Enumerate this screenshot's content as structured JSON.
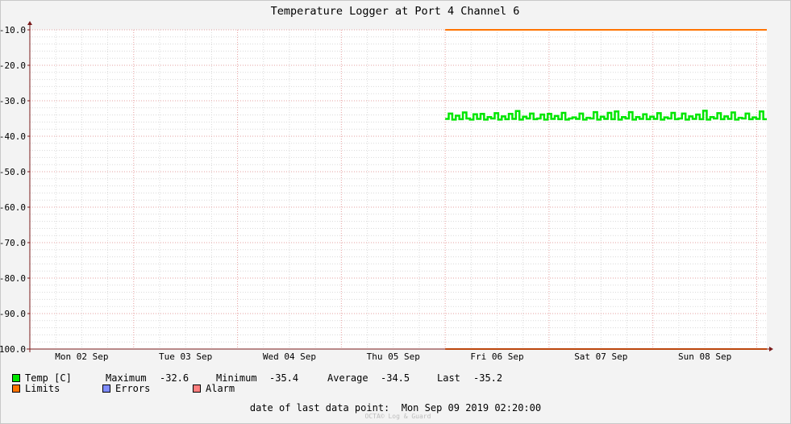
{
  "chart_data": {
    "type": "line",
    "title": "Temperature Logger at Port 4 Channel 6",
    "ylim": [
      -100,
      -10
    ],
    "y_ticks": [
      -10,
      -20,
      -30,
      -40,
      -50,
      -60,
      -70,
      -80,
      -90,
      -100
    ],
    "y_tick_labels": [
      "-10.0",
      "-20.0",
      "-30.0",
      "-40.0",
      "-50.0",
      "-60.0",
      "-70.0",
      "-80.0",
      "-90.0",
      "-100.0"
    ],
    "x_tick_labels": [
      "Mon 02 Sep",
      "Tue 03 Sep",
      "Wed 04 Sep",
      "Thu 05 Sep",
      "Fri 06 Sep",
      "Sat 07 Sep",
      "Sun 08 Sep"
    ],
    "xlim": [
      "2019-09-02 00:00",
      "2019-09-09 02:20"
    ],
    "grid": true,
    "series": [
      {
        "name": "Temp [C]",
        "color": "#00e600",
        "x_start": "2019-09-06 00:00",
        "x_end": "2019-09-09 02:20",
        "values": [
          -35.1,
          -33.6,
          -35.3,
          -34.2,
          -35.2,
          -33.3,
          -35.0,
          -35.3,
          -33.8,
          -35.1,
          -33.7,
          -35.3,
          -34.6,
          -35.0,
          -33.5,
          -35.3,
          -34.4,
          -35.2,
          -33.7,
          -35.1,
          -32.9,
          -35.3,
          -34.5,
          -35.0,
          -33.6,
          -35.2,
          -35.0,
          -33.9,
          -35.3,
          -33.7,
          -35.1,
          -34.3,
          -35.2,
          -33.4,
          -35.3,
          -35.0,
          -34.7,
          -35.1,
          -33.6,
          -35.3,
          -34.8,
          -35.0,
          -33.2,
          -35.3,
          -34.5,
          -35.1,
          -33.4,
          -35.2,
          -33.0,
          -35.3,
          -34.6,
          -35.0,
          -33.2,
          -35.3,
          -34.6,
          -35.1,
          -33.8,
          -35.2,
          -34.5,
          -35.1,
          -33.5,
          -35.3,
          -34.7,
          -35.0,
          -33.4,
          -35.2,
          -35.0,
          -33.6,
          -35.3,
          -34.4,
          -35.1,
          -33.9,
          -35.2,
          -32.8,
          -35.3,
          -34.6,
          -35.0,
          -33.5,
          -35.2,
          -34.4,
          -35.1,
          -33.3,
          -35.3,
          -34.8,
          -35.0,
          -33.6,
          -35.2,
          -34.7,
          -35.1,
          -33.0,
          -35.2
        ]
      },
      {
        "name": "Limits",
        "color": "#ff7300",
        "x_start": "2019-09-06 00:00",
        "x_end": "2019-09-09 02:20",
        "upper": -10.0,
        "lower": -100.0
      }
    ]
  },
  "legend": {
    "temp": {
      "label": "Temp [C]",
      "color": "#00e600",
      "max_label": "Maximum",
      "max_value": "-32.6",
      "min_label": "Minimum",
      "min_value": "-35.4",
      "avg_label": "Average",
      "avg_value": "-34.5",
      "last_label": "Last",
      "last_value": "-35.2"
    },
    "limits": {
      "label": "Limits",
      "color": "#ff7300"
    },
    "errors": {
      "label": "Errors",
      "color": "#7f8cff"
    },
    "alarm": {
      "label": "Alarm",
      "color": "#ff7f7f"
    }
  },
  "footer": {
    "date_label": "date of last data point:",
    "date_value": "Mon Sep 09 2019 02:20:00",
    "watermark": "OCTA© Log & Guard"
  }
}
